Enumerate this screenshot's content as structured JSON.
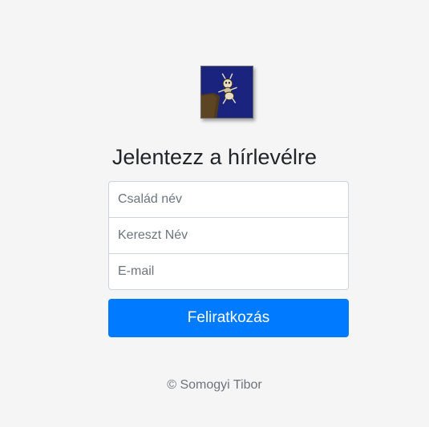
{
  "form": {
    "title": "Jelentezz a hírlevélre",
    "last_name_placeholder": "Család név",
    "first_name_placeholder": "Kereszt Név",
    "email_placeholder": "E-mail",
    "submit_label": "Feliratkozás"
  },
  "footer": {
    "copyright": "© Somogyi Tibor"
  },
  "logo": {
    "icon": "ant-on-cliff-logo",
    "background_color": "#1a237e"
  },
  "colors": {
    "primary": "#007bff",
    "background": "#f5f5f5"
  }
}
